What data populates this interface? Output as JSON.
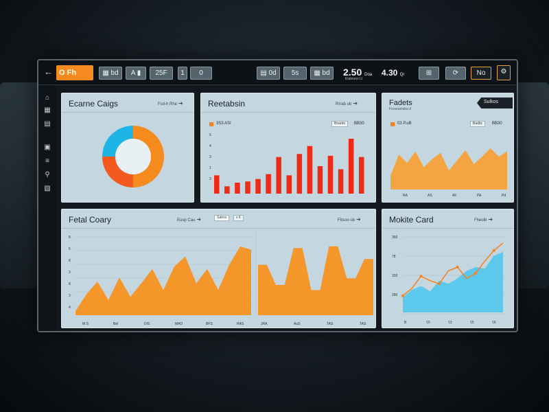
{
  "topbar": {
    "back_icon": "back-arrow-icon",
    "brand_label": "O Fh",
    "buttons": [
      {
        "label": "bd",
        "icon": "grid-icon"
      },
      {
        "label": "A",
        "icon": "bar-icon"
      },
      {
        "label": "25F",
        "icon": "chart-icon"
      },
      {
        "label": "1",
        "icon": "bars-icon"
      },
      {
        "label": "0",
        "icon": "circle-icon"
      }
    ],
    "right_buttons": [
      "0d",
      "5s",
      "bd"
    ],
    "metric1_value": "2.50",
    "metric1_sub": "Doa",
    "metric1_caption": "Elateuoo Lt",
    "metric2_value": "4.30",
    "metric2_sub": "Qr",
    "icon_buttons": [
      "grid-icon",
      "refresh-icon",
      "gauge-icon"
    ],
    "notif_label": "No",
    "settings_icon": "settings-icon"
  },
  "sidebar": {
    "items": [
      "home-icon",
      "grid-icon",
      "table-icon",
      "folder-icon",
      "layers-icon",
      "pin-icon",
      "doc-icon"
    ]
  },
  "cards": {
    "donut": {
      "title": "Ecarne Caigs",
      "link": "Fcd-h Rhe",
      "chart_data": {
        "type": "pie",
        "slices": [
          {
            "value": 50,
            "color": "#f58a1f"
          },
          {
            "value": 25,
            "color": "#f45a1e"
          },
          {
            "value": 25,
            "color": "#1fb4e6"
          }
        ]
      }
    },
    "bars": {
      "title": "Reetabsin",
      "link": "Rrrab ub",
      "legend": "3S3 ASI",
      "pill": "Boarde",
      "pill_value": "BB30",
      "yticks": [
        "5",
        "4",
        "3",
        "1",
        "3"
      ],
      "chart_data": {
        "type": "bar",
        "color": "#ef2a16",
        "values": [
          30,
          12,
          18,
          20,
          24,
          32,
          60,
          30,
          65,
          78,
          45,
          62,
          40,
          90,
          60
        ]
      }
    },
    "area_small": {
      "title": "Fadets",
      "subtitle": "Ferseuelaba d",
      "tab": "Sulkos",
      "legend": "03 P.uB",
      "pill": "Badbc",
      "pill_value": "BB30",
      "xticks": [
        "RA",
        "AS",
        "AF",
        "PA",
        "Pd"
      ],
      "chart_data": {
        "type": "area",
        "color": "#f5a442",
        "values": [
          22,
          55,
          42,
          60,
          35,
          48,
          58,
          30,
          46,
          62,
          40,
          52,
          65,
          52,
          60
        ]
      }
    },
    "area_large": {
      "title": "Fetal Coary",
      "link1": "Eusp Cau",
      "tab1": "Satros",
      "tab2": "x 6",
      "link2": "Fbsoo ub",
      "yticks": [
        "8",
        "5",
        "8",
        "3",
        "8",
        "3",
        "4"
      ],
      "xticks": [
        "M.S",
        "Bel",
        "DIS",
        "MAD",
        "BFS",
        "RAS"
      ],
      "xticks2": [
        "JRA",
        "AuS",
        "TAS",
        "TAS"
      ],
      "chart_data": {
        "type": "area",
        "color": "#f5962a",
        "values": [
          5,
          25,
          40,
          18,
          45,
          22,
          38,
          55,
          30,
          58,
          70,
          38,
          55,
          30,
          60,
          82,
          78
        ],
        "step_values": [
          60,
          60,
          36,
          36,
          80,
          80,
          30,
          30,
          82,
          82,
          44,
          44,
          67,
          67
        ]
      }
    },
    "mixed": {
      "title": "Mokite Card",
      "link": "Fheolb",
      "yticks": [
        "350",
        "78",
        "320",
        "280"
      ],
      "xticks": [
        "B",
        "10",
        "13",
        "15",
        "16"
      ],
      "chart_data": {
        "type": "line",
        "area_color": "#5cc8ec",
        "line_color": "#f5821e",
        "area_values": [
          20,
          30,
          35,
          28,
          42,
          38,
          45,
          55,
          60,
          58,
          75,
          80
        ],
        "line_values": [
          22,
          32,
          48,
          42,
          38,
          55,
          60,
          45,
          52,
          68,
          82,
          92
        ]
      }
    }
  }
}
